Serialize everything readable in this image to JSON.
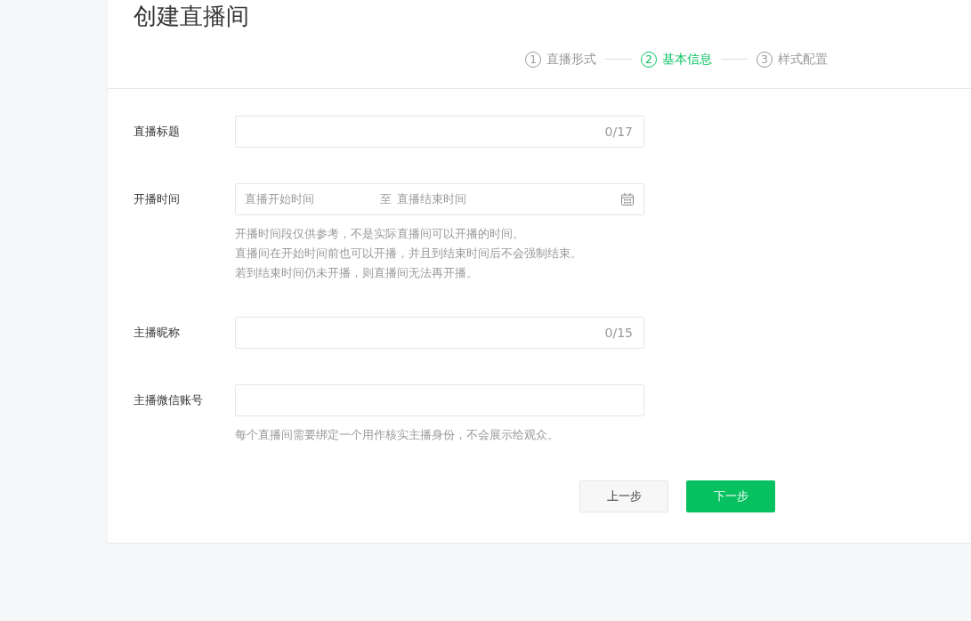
{
  "page_title": "创建直播间",
  "steps": [
    {
      "number": "1",
      "label": "直播形式",
      "selected": false
    },
    {
      "number": "2",
      "label": "基本信息",
      "selected": true
    },
    {
      "number": "3",
      "label": "样式配置",
      "selected": false
    }
  ],
  "fields": [
    {
      "kind": "text",
      "label": "直播标题",
      "counter": "0/17"
    },
    {
      "kind": "daterange",
      "label": "开播时间",
      "start_placeholder": "直播开始时间",
      "separator": "至",
      "end_placeholder": "直播结束时间",
      "hints": [
        "开播时间段仅供参考，不是实际直播间可以开播的时间。",
        "直播间在开始时间前也可以开播，并且到结束时间后不会强制结束。",
        "若到结束时间仍未开播，则直播间无法再开播。"
      ]
    },
    {
      "kind": "text",
      "label": "主播昵称",
      "counter": "0/15"
    },
    {
      "kind": "text",
      "label": "主播微信账号",
      "hints": [
        "每个直播间需要绑定一个用作核实主播身份，不会展示给观众。"
      ]
    }
  ],
  "buttons": {
    "back": "上一步",
    "next": "下一步"
  }
}
